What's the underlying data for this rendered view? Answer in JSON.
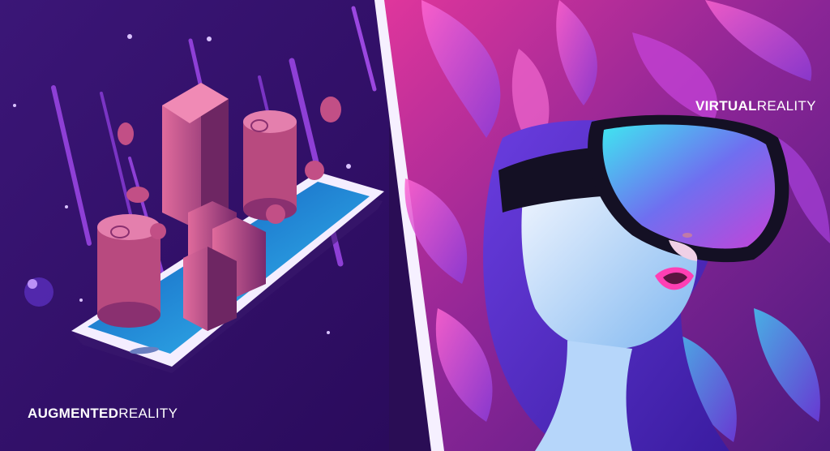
{
  "augmented": {
    "bold": "AUGMENTED",
    "light": "REALITY"
  },
  "virtual": {
    "bold": "VIRTUAL",
    "light": "REALITY"
  },
  "colors": {
    "background_left": "#3a1573",
    "background_right": "#6a1d8a",
    "accent_cyan": "#3fe6f0",
    "accent_pink": "#ff3fb4",
    "building": "#b6437a",
    "screen": "#1e9ce8"
  }
}
